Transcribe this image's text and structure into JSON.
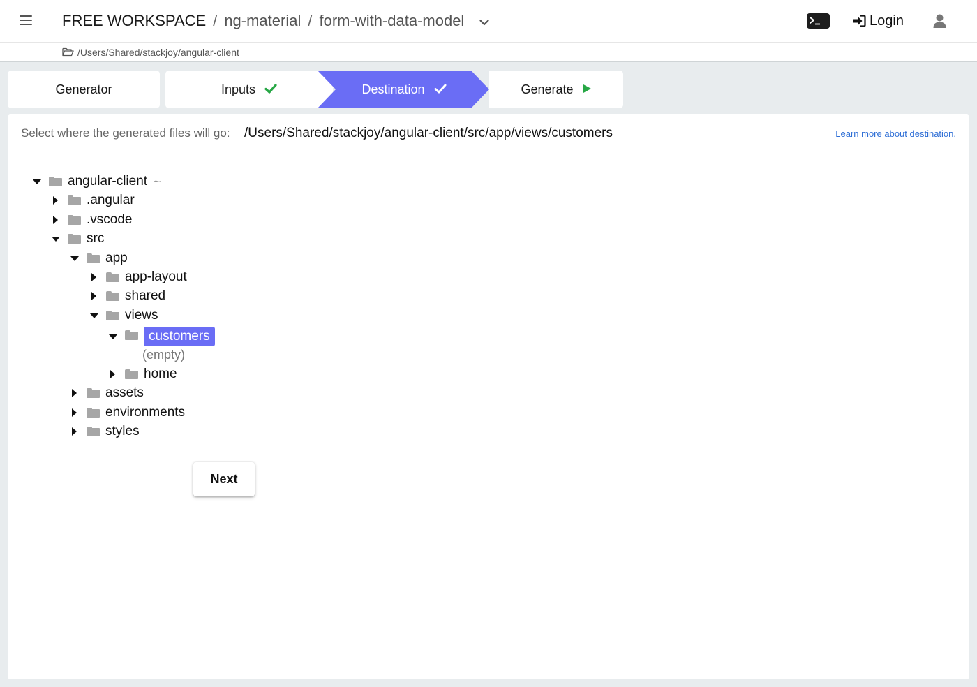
{
  "header": {
    "workspace": "FREE WORKSPACE",
    "separator": "/",
    "project": "ng-material",
    "page": "form-with-data-model",
    "login_label": "Login"
  },
  "path_bar": {
    "path": "/Users/Shared/stackjoy/angular-client"
  },
  "stepper": {
    "steps": [
      {
        "label": "Generator",
        "state": "default"
      },
      {
        "label": "Inputs",
        "state": "done",
        "icon": "check-icon"
      },
      {
        "label": "Destination",
        "state": "active",
        "icon": "check-icon"
      },
      {
        "label": "Generate",
        "state": "pending",
        "icon": "play-icon"
      }
    ]
  },
  "destination": {
    "prompt": "Select where the generated files will go:",
    "selected_path": "/Users/Shared/stackjoy/angular-client/src/app/views/customers",
    "learn_more": "Learn more about destination."
  },
  "tree": {
    "root": {
      "label": "angular-client",
      "suffix": "~"
    },
    "nodes": [
      {
        "label": ".angular"
      },
      {
        "label": ".vscode"
      },
      {
        "label": "src"
      },
      {
        "label": "app"
      },
      {
        "label": "app-layout"
      },
      {
        "label": "shared"
      },
      {
        "label": "views"
      },
      {
        "label": "customers"
      },
      {
        "label": "home"
      },
      {
        "label": "assets"
      },
      {
        "label": "environments"
      },
      {
        "label": "styles"
      }
    ],
    "empty_note": "(empty)"
  },
  "actions": {
    "next_label": "Next"
  },
  "colors": {
    "accent": "#6a6df5",
    "success": "#27a745",
    "link": "#2f6fd6"
  }
}
